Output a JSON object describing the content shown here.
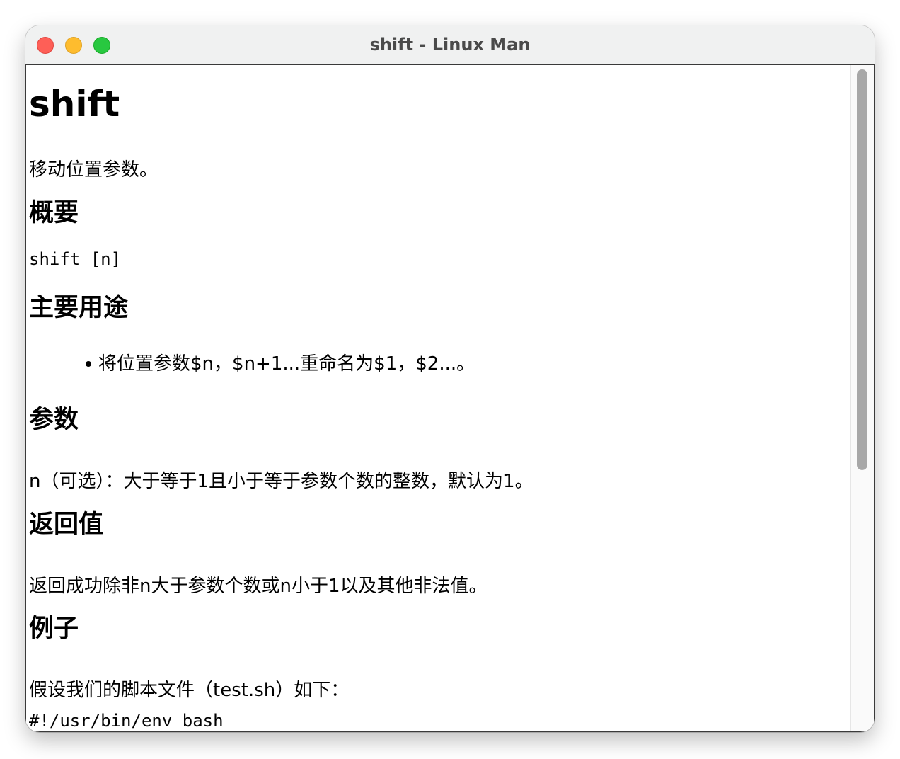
{
  "window": {
    "title": "shift - Linux Man"
  },
  "doc": {
    "title": "shift",
    "summary": "移动位置参数。",
    "synopsis_heading": "概要",
    "synopsis_code": "shift [n]",
    "usage_heading": "主要用途",
    "usage_items": [
      "将位置参数$n，$n+1...重命名为$1，$2...。"
    ],
    "params_heading": "参数",
    "params_text": "n（可选）：大于等于1且小于等于参数个数的整数，默认为1。",
    "return_heading": "返回值",
    "return_text": "返回成功除非n大于参数个数或n小于1以及其他非法值。",
    "example_heading": "例子",
    "example_intro": "假设我们的脚本文件（test.sh）如下：",
    "example_code_first_line": "#!/usr/bin/env bash"
  }
}
